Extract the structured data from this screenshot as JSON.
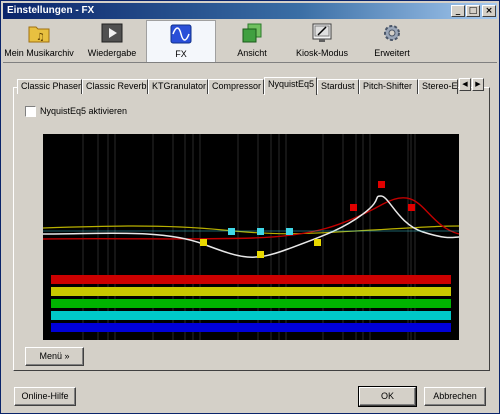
{
  "window": {
    "title": "Einstellungen - FX"
  },
  "titlebar_buttons": {
    "minimize": "_",
    "maximize": "□",
    "close": "×"
  },
  "toolbar": {
    "items": [
      {
        "label": "Mein Musikarchiv",
        "icon": "music-folder-icon"
      },
      {
        "label": "Wiedergabe",
        "icon": "playback-icon"
      },
      {
        "label": "FX",
        "icon": "waveform-icon",
        "active": true
      },
      {
        "label": "Ansicht",
        "icon": "view-icon"
      },
      {
        "label": "Kiosk-Modus",
        "icon": "kiosk-icon"
      },
      {
        "label": "Erweitert",
        "icon": "gear-icon"
      }
    ]
  },
  "tabs": [
    {
      "label": "Classic Phaser"
    },
    {
      "label": "Classic Reverb"
    },
    {
      "label": "KTGranulator"
    },
    {
      "label": "Compressor"
    },
    {
      "label": "NyquistEq5",
      "active": true
    },
    {
      "label": "Stardust"
    },
    {
      "label": "Pitch-Shifter"
    },
    {
      "label": "Stereo-Ei"
    }
  ],
  "tab_scroll": {
    "left": "◀",
    "right": "▶"
  },
  "eq": {
    "enable_label": "NyquistEq5 aktivieren",
    "enabled": false,
    "band_colors": [
      "#cc0000",
      "#c8c800",
      "#00b400",
      "#00c8c8",
      "#0000d8"
    ],
    "curve_colors": {
      "white": "#e8e8e8",
      "yellow": "#d8d000",
      "red": "#c00000",
      "cyan": "#40d8e8"
    }
  },
  "buttons": {
    "menu": "Menü »",
    "help": "Online-Hilfe",
    "ok": "OK",
    "cancel": "Abbrechen"
  }
}
